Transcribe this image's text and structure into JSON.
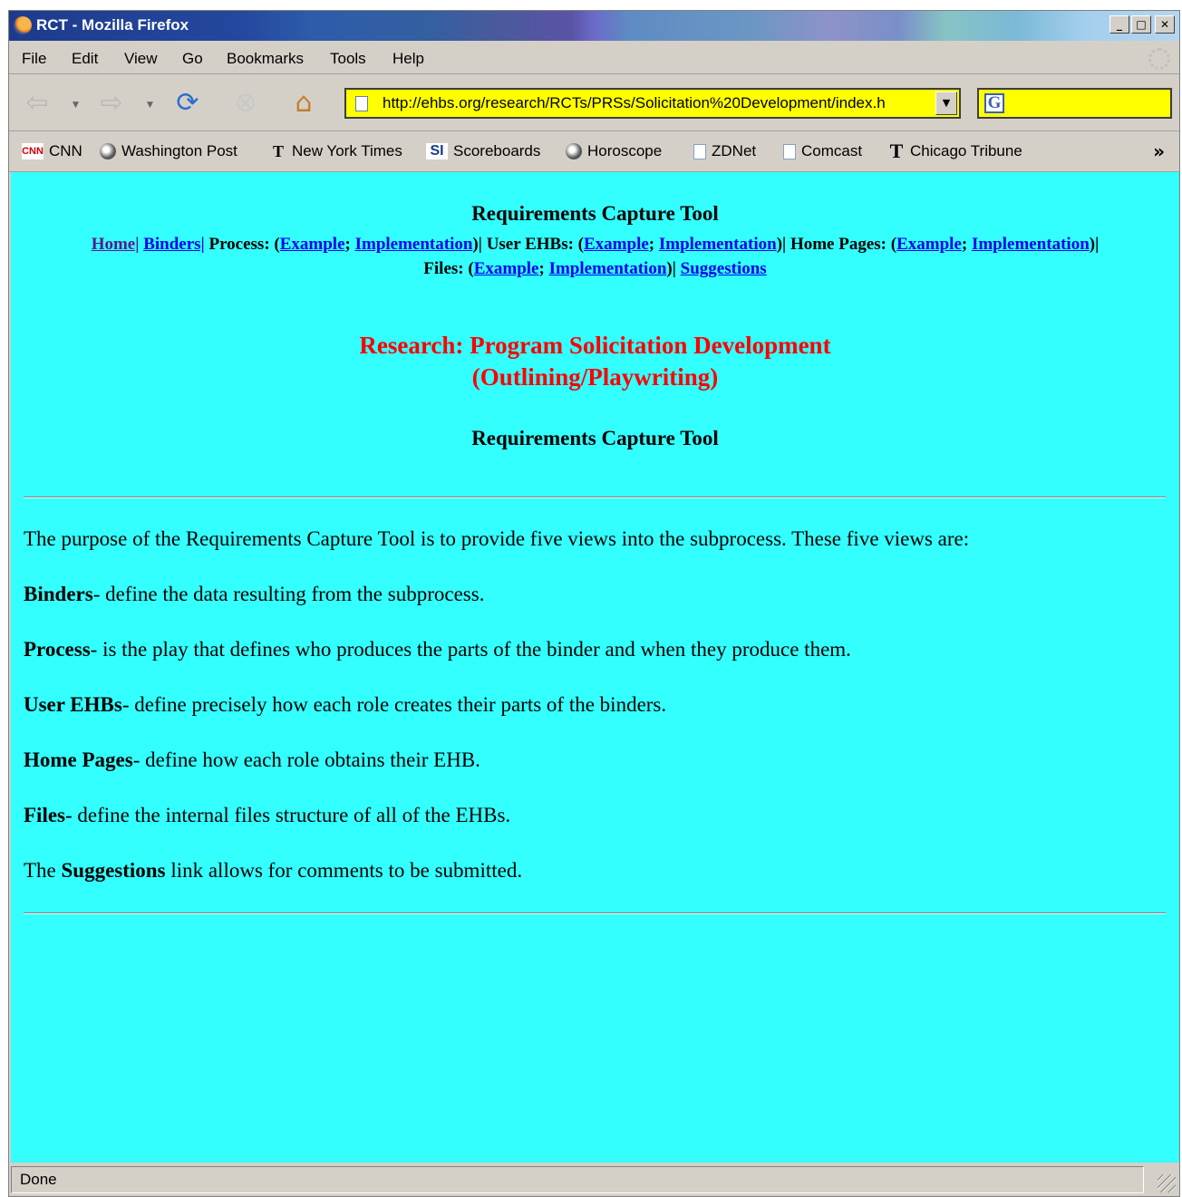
{
  "window": {
    "title": "RCT - Mozilla Firefox",
    "min": "_",
    "max": "□",
    "close": "✕"
  },
  "menu": [
    "File",
    "Edit",
    "View",
    "Go",
    "Bookmarks",
    "Tools",
    "Help"
  ],
  "nav": {
    "url": "http://ehbs.org/research/RCTs/PRSs/Solicitation%20Development/index.h"
  },
  "bookmarks": [
    "CNN",
    "Washington Post",
    "New York Times",
    "Scoreboards",
    "Horoscope",
    "ZDNet",
    "Comcast",
    "Chicago Tribune"
  ],
  "page": {
    "tool_title": "Requirements Capture Tool",
    "links": {
      "home": "Home|",
      "binders": "Binders|",
      "process_label": "Process: (",
      "example": "Example",
      "semi": ";",
      "implementation": "Implementation",
      "close_sep": ")|",
      "user_ehbs_label": "User EHBs: (",
      "home_pages_label": "Home Pages: (",
      "files_label": "Files: (",
      "suggestions": "Suggestions"
    },
    "heading_line1": "Research: Program Solicitation Development",
    "heading_line2": "(Outlining/Playwriting)",
    "tool_title2": "Requirements Capture Tool",
    "intro": "The purpose of the Requirements Capture Tool is to provide five views into the subprocess. These five views are:",
    "views": [
      {
        "term": "Binders",
        "desc": "- define the data resulting from the subprocess."
      },
      {
        "term": "Process",
        "desc": "- is the play that defines who produces the parts of the binder and when they produce them."
      },
      {
        "term": "User EHBs",
        "desc": "- define precisely how each role creates their parts of the binders."
      },
      {
        "term": "Home Pages",
        "desc": "- define how each role obtains their EHB."
      },
      {
        "term": "Files",
        "desc": "- define the internal files structure of all of the EHBs."
      }
    ],
    "suggest_pre": "The ",
    "suggest_term": "Suggestions",
    "suggest_post": " link allows for comments to be submitted."
  },
  "status": "Done",
  "colors": {
    "page_bg": "#33ffff",
    "heading_red": "#ff0000",
    "urlbar_bg": "#ffff00"
  }
}
